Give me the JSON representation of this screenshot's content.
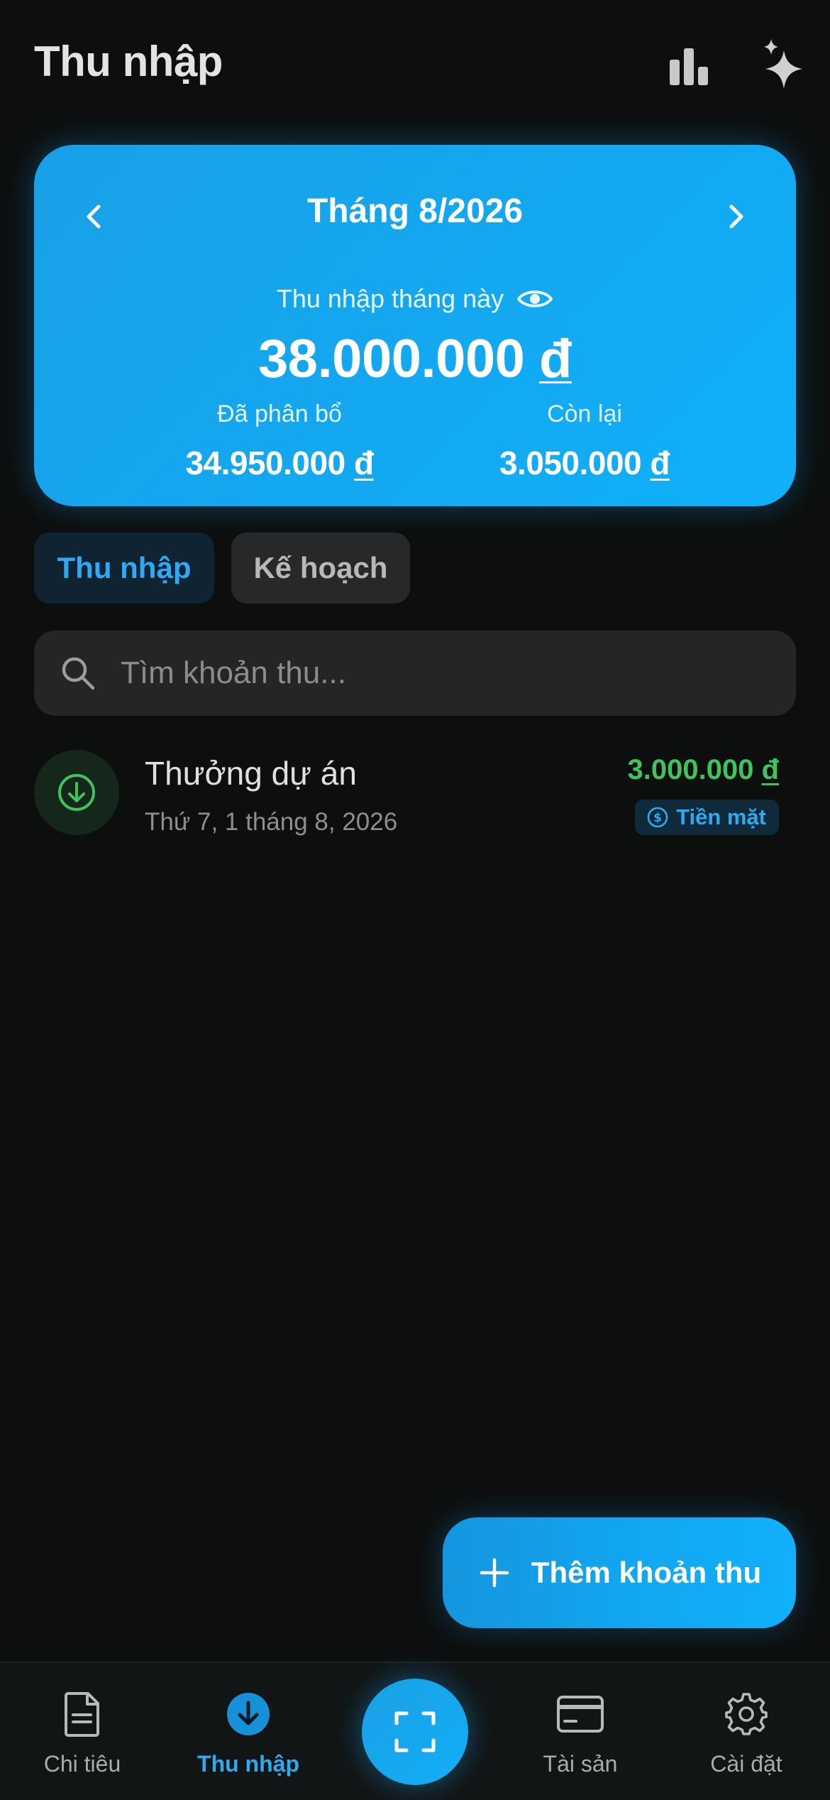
{
  "header": {
    "title": "Thu nhập",
    "chart_icon": "bar-chart-icon",
    "ai_icon": "sparkle-icon"
  },
  "summary": {
    "month": "Tháng 8/2026",
    "income_label": "Thu nhập tháng này",
    "income_value": "38.000.000",
    "allocated_label": "Đã phân bổ",
    "allocated_value": "34.950.000",
    "remaining_label": "Còn lại",
    "remaining_value": "3.050.000",
    "currency": "đ"
  },
  "tabs": [
    {
      "label": "Thu nhập",
      "active": true
    },
    {
      "label": "Kế hoạch",
      "active": false
    }
  ],
  "search": {
    "placeholder": "Tìm khoản thu..."
  },
  "incomes": [
    {
      "title": "Thưởng dự án",
      "date": "Thứ 7, 1 tháng 8, 2026",
      "amount": "3.000.000",
      "currency": "đ",
      "method": "Tiền mặt"
    }
  ],
  "fab": {
    "label": "Thêm khoản thu"
  },
  "bottom_nav": [
    {
      "label": "Chi tiêu",
      "icon": "document-icon",
      "active": false
    },
    {
      "label": "Thu nhập",
      "icon": "income-icon",
      "active": true
    },
    {
      "label": "",
      "icon": "scan-icon",
      "active": false
    },
    {
      "label": "Tài sản",
      "icon": "card-icon",
      "active": false
    },
    {
      "label": "Cài đặt",
      "icon": "gear-icon",
      "active": false
    }
  ],
  "colors": {
    "background": "#0d0f0f",
    "accent": "#12a8f2",
    "income_green": "#3ec45c",
    "tab_active_text": "#2eaaf2"
  }
}
